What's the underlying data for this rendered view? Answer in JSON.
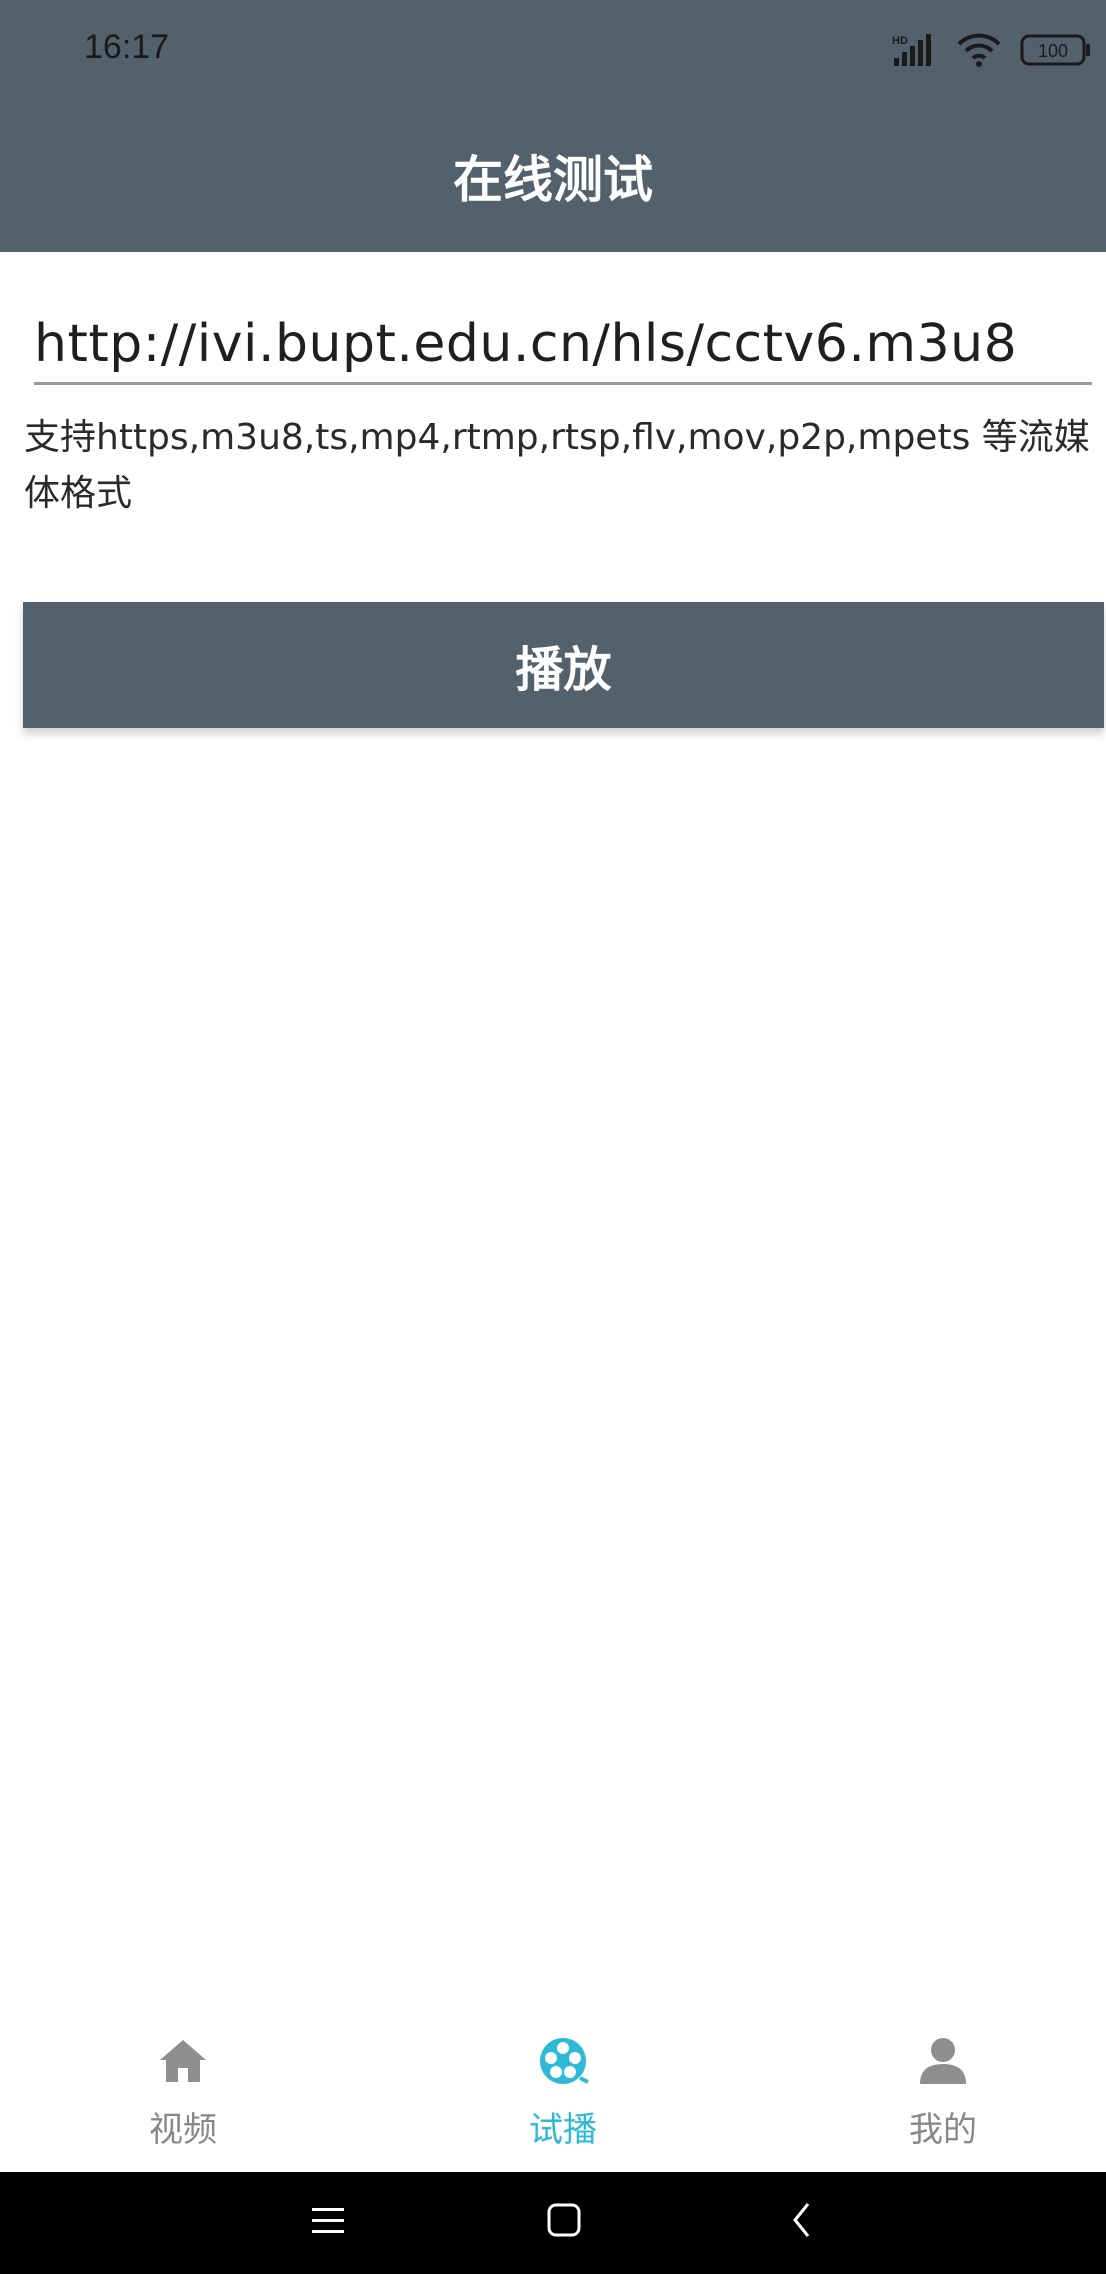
{
  "status_bar": {
    "time": "16:17",
    "battery": "100"
  },
  "header": {
    "title": "在线测试"
  },
  "url_input": {
    "value": "http://ivi.bupt.edu.cn/hls/cctv6.m3u8"
  },
  "hint": {
    "text": "支持https,m3u8,ts,mp4,rtmp,rtsp,flv,mov,p2p,mpets 等流媒体格式"
  },
  "play_button": {
    "label": "播放"
  },
  "bottom_nav": {
    "items": [
      {
        "label": "视频",
        "icon": "home-icon",
        "active": false
      },
      {
        "label": "试播",
        "icon": "film-reel-icon",
        "active": true
      },
      {
        "label": "我的",
        "icon": "person-icon",
        "active": false
      }
    ]
  },
  "colors": {
    "header": "#53616d",
    "accent": "#2eb9d6",
    "inactive": "#888888"
  }
}
